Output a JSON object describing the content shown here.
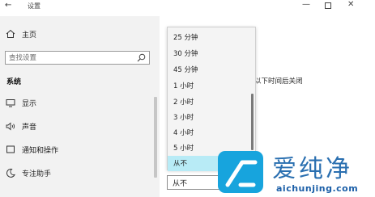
{
  "window": {
    "back_glyph": "←",
    "title": "设置",
    "min_glyph": "—",
    "close_glyph": "✕"
  },
  "sidebar": {
    "home": {
      "label": "主页",
      "icon": "home-icon"
    },
    "search": {
      "placeholder": "查找设置",
      "icon": "search-icon"
    },
    "section_title": "系统",
    "items": [
      {
        "label": "显示",
        "icon": "monitor-icon"
      },
      {
        "label": "声音",
        "icon": "speaker-icon"
      },
      {
        "label": "通知和操作",
        "icon": "notification-icon"
      },
      {
        "label": "专注助手",
        "icon": "moon-icon"
      }
    ]
  },
  "content": {
    "description_text": "以下时间后关闭",
    "select_value": "从不"
  },
  "dropdown": {
    "options": [
      "25 分钟",
      "30 分钟",
      "45 分钟",
      "1 小时",
      "2 小时",
      "3 小时",
      "4 小时",
      "5 小时",
      "从不"
    ],
    "selected": "从不",
    "highlight_color": "#b8ebf6"
  },
  "watermark": {
    "brand_cn": "爱纯净",
    "url": "aichunjing.com",
    "logo_color": "#17a4dd"
  }
}
